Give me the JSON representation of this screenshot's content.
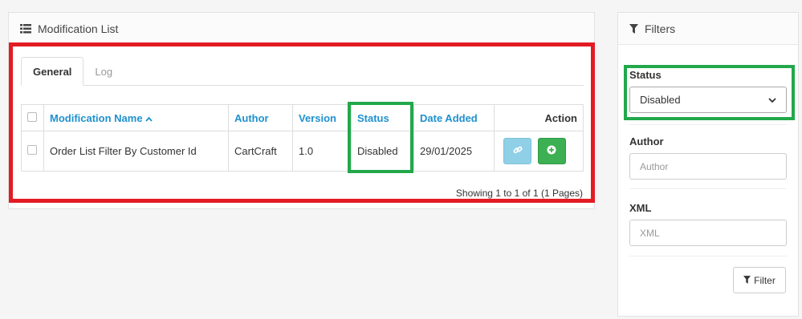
{
  "modification_list": {
    "title": "Modification List",
    "tabs": [
      {
        "label": "General",
        "active": true
      },
      {
        "label": "Log",
        "active": false
      }
    ],
    "table": {
      "headers": {
        "name": "Modification Name",
        "author": "Author",
        "version": "Version",
        "status": "Status",
        "date_added": "Date Added",
        "action": "Action"
      },
      "rows": [
        {
          "name": "Order List Filter By Customer Id",
          "author": "CartCraft",
          "version": "1.0",
          "status": "Disabled",
          "date_added": "29/01/2025"
        }
      ]
    },
    "pagination": "Showing 1 to 1 of 1 (1 Pages)"
  },
  "filters": {
    "title": "Filters",
    "status_label": "Status",
    "status_value": "Disabled",
    "author_label": "Author",
    "author_placeholder": "Author",
    "xml_label": "XML",
    "xml_placeholder": "XML",
    "filter_button": "Filter"
  },
  "colors": {
    "link_blue": "#1e91cf",
    "highlight_red": "#e31b23",
    "highlight_green": "#22a84b",
    "btn_info": "#8fd0e7",
    "btn_success": "#3cb052"
  },
  "icons": [
    "list-icon",
    "filter-icon",
    "sort-up-icon",
    "link-icon",
    "plus-circle-icon",
    "chevron-down-icon"
  ]
}
